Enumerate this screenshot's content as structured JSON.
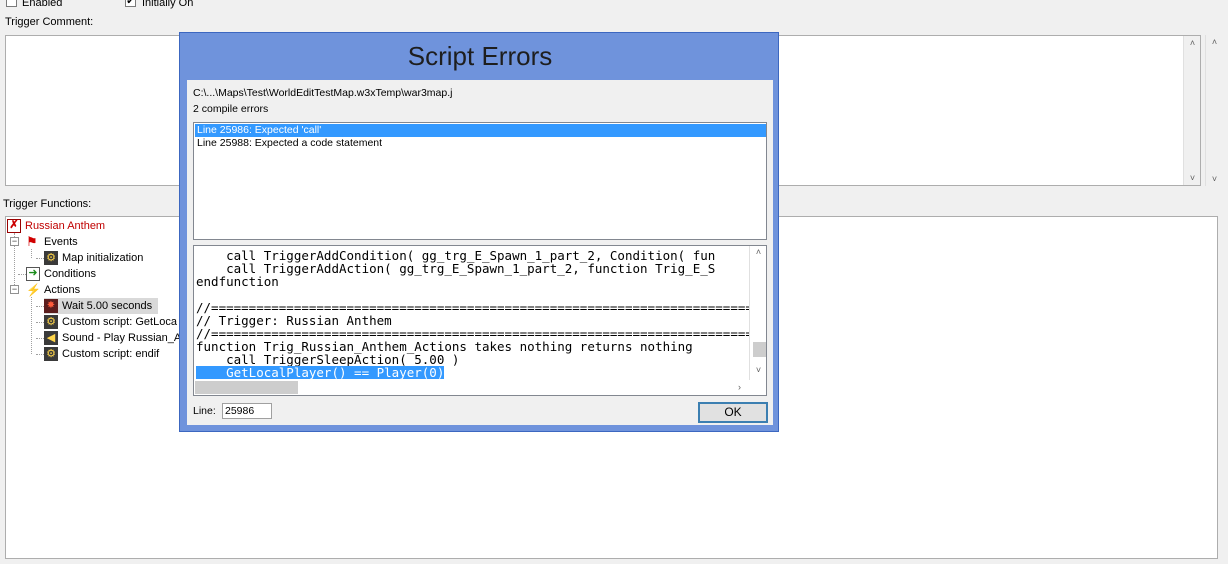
{
  "top": {
    "enabled_label": "Enabled",
    "initially_on_label": "Initially On",
    "trigger_comment_label": "Trigger Comment:",
    "trigger_functions_label": "Trigger Functions:"
  },
  "tree": {
    "root": "Russian Anthem",
    "events": "Events",
    "event_items": [
      "Map initialization"
    ],
    "conditions": "Conditions",
    "actions": "Actions",
    "action_items": [
      "Wait 5.00 seconds",
      "Custom script:   GetLoca",
      "Sound - Play Russian_A",
      "Custom script:   endif"
    ]
  },
  "dialog": {
    "title": "Script Errors",
    "path": "C:\\...\\Maps\\Test\\WorldEditTestMap.w3xTemp\\war3map.j",
    "count": "2 compile errors",
    "errors": [
      "Line 25986: Expected 'call'",
      "Line 25988: Expected a code statement"
    ],
    "code_lines": [
      "    call TriggerAddCondition( gg_trg_E_Spawn_1_part_2, Condition( fun",
      "    call TriggerAddAction( gg_trg_E_Spawn_1_part_2, function Trig_E_S",
      "endfunction",
      "",
      "//===========================================================================",
      "// Trigger: Russian Anthem",
      "//===========================================================================",
      "function Trig_Russian_Anthem_Actions takes nothing returns nothing",
      "    call TriggerSleepAction( 5.00 )",
      "    GetLocalPlayer() == Player(0)"
    ],
    "line_label": "Line:",
    "line_value": "25986",
    "ok_label": "OK"
  },
  "colors": {
    "dialog_frame": "#6f93dc",
    "selection": "#3399ff",
    "root_text": "#c00000"
  }
}
